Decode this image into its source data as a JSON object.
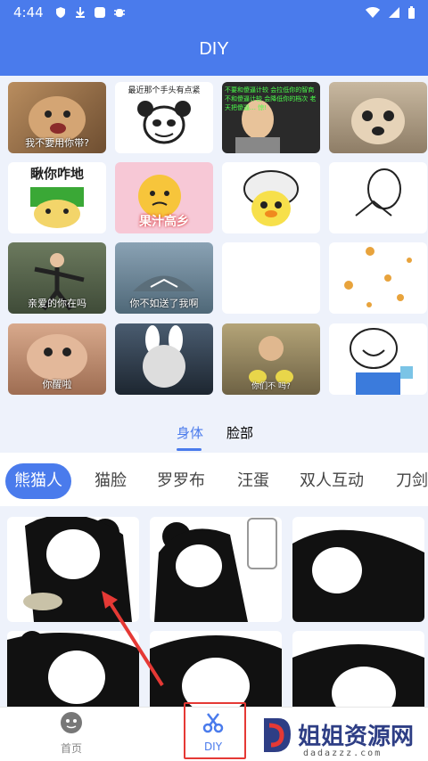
{
  "status_bar": {
    "time": "4:44"
  },
  "header": {
    "title": "DIY"
  },
  "meme_grid": {
    "captions": [
      "我不要用你带?",
      "最近那个手头有点紧",
      "不要和傻逼计较 会拉低你的智商 不和傻逼计较 会降低你的档次 老天把傻逼… 惊!",
      "",
      "瞅你咋地",
      "果汁高乡",
      "",
      "",
      "亲爱的你在吗",
      "你不如送了我啊",
      "",
      "",
      "你醒啦",
      "",
      "你们不 吗?",
      ""
    ]
  },
  "tabs": [
    {
      "label": "身体",
      "active": true
    },
    {
      "label": "脸部",
      "active": false
    }
  ],
  "categories": [
    {
      "label": "熊猫人",
      "active": true
    },
    {
      "label": "猫脸",
      "active": false
    },
    {
      "label": "罗罗布",
      "active": false
    },
    {
      "label": "汪蛋",
      "active": false
    },
    {
      "label": "双人互动",
      "active": false
    },
    {
      "label": "刀剑",
      "active": false
    }
  ],
  "bottom_nav": {
    "home_label": "首页",
    "diy_label": "DIY"
  },
  "watermark": {
    "text": "姐姐资源网",
    "sub": "dadazzz.com"
  },
  "colors": {
    "accent": "#4a7bec",
    "highlight": "#e53935"
  }
}
